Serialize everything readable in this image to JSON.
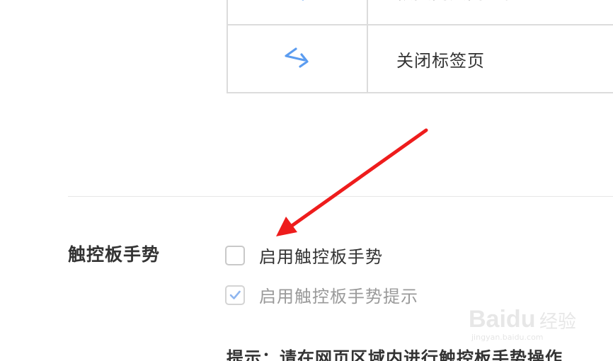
{
  "gestures": [
    {
      "label": "恢复刚关闭的标签",
      "icon": "swipe-left-arrow-icon"
    },
    {
      "label": "关闭标签页",
      "icon": "swipe-v-arrow-icon"
    }
  ],
  "touchpad": {
    "title": "触控板手势",
    "options": [
      {
        "label": "启用触控板手势",
        "checked": false
      },
      {
        "label": "启用触控板手势提示",
        "checked": true
      }
    ],
    "hint": "提示：请在网页区域内进行触控板手势操作"
  },
  "watermark": {
    "brand": "Bai",
    "brand_tail": "du",
    "suffix": "经验",
    "url": "jingyan.baidu.com"
  },
  "colors": {
    "accent_blue": "#5b9cf0",
    "annotation_red": "#ee1c1c",
    "border": "#dcdcdc"
  }
}
